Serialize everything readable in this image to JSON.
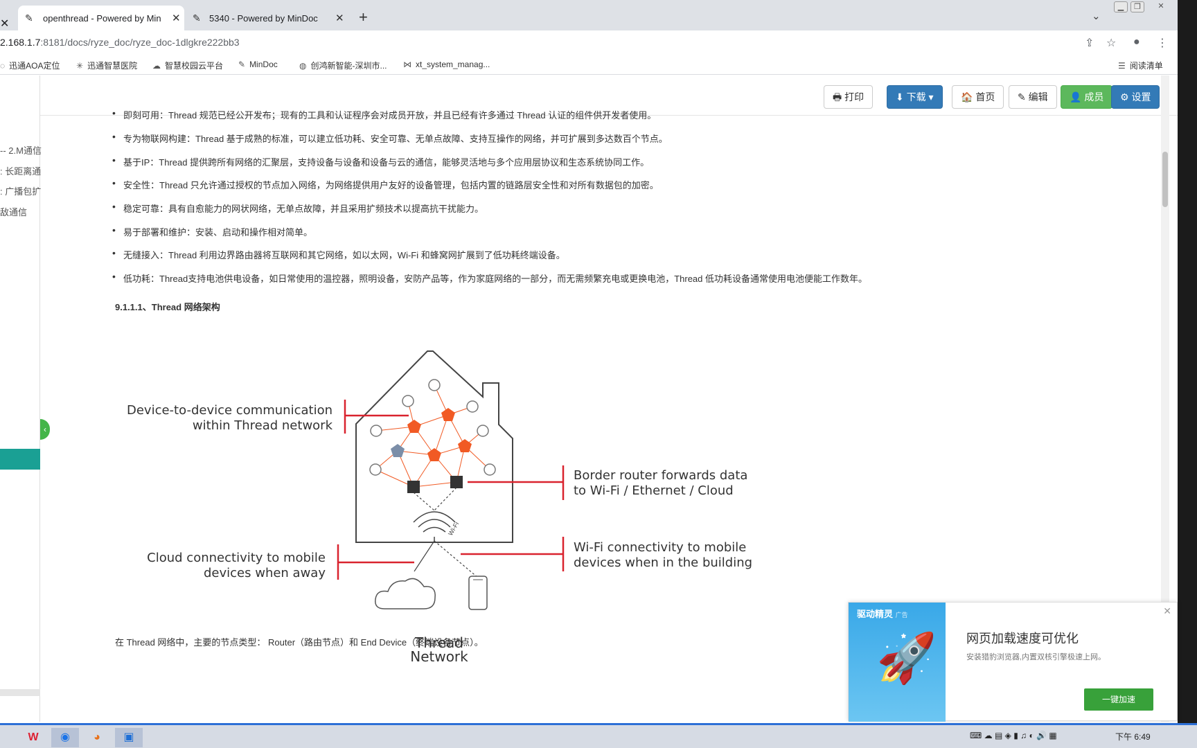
{
  "browser": {
    "tabs": [
      {
        "title": "openthread - Powered by Min",
        "active": true
      },
      {
        "title": "5340 - Powered by MinDoc",
        "active": false
      }
    ],
    "url_host": "2.168.1.7",
    "url_path": ":8181/docs/ryze_doc/ryze_doc-1dlgkre222bb3",
    "bookmarks": [
      "迅通AOA定位",
      "迅通智慧医院",
      "智慧校园云平台",
      "MinDoc",
      "创鸿新智能-深圳市...",
      "xt_system_manag..."
    ],
    "reading_list": "阅读清单"
  },
  "sidebar": {
    "items": [
      "-- 2.M通信",
      ": 长距离通",
      ": 广播包扩",
      "敌通信"
    ]
  },
  "toolbar": {
    "print": "🖶 打印",
    "download": "⬇ 下载 ▾",
    "home": "🏠 首页",
    "edit": "✎ 编辑",
    "members": "👤 成员",
    "settings": "⚙ 设置"
  },
  "doc": {
    "bullets": [
      "即刻可用：Thread 规范已经公开发布；现有的工具和认证程序会对成员开放，并且已经有许多通过 Thread 认证的组件供开发者使用。",
      "专为物联网构建：Thread 基于成熟的标准，可以建立低功耗、安全可靠、无单点故障、支持互操作的网络，并可扩展到多达数百个节点。",
      "基于IP：Thread 提供跨所有网络的汇聚层，支持设备与设备和设备与云的通信，能够灵活地与多个应用层协议和生态系统协同工作。",
      "安全性：Thread 只允许通过授权的节点加入网络，为网络提供用户友好的设备管理，包括内置的链路层安全性和对所有数据包的加密。",
      "稳定可靠：具有自愈能力的网状网络，无单点故障，并且采用扩频技术以提高抗干扰能力。",
      "易于部署和维护：安装、启动和操作相对简单。",
      "无缝接入：Thread 利用边界路由器将互联网和其它网络，如以太网，Wi-Fi 和蜂窝网扩展到了低功耗终端设备。",
      "低功耗：Thread支持电池供电设备，如日常使用的温控器，照明设备，安防产品等，作为家庭网络的一部分，而无需频繁充电或更换电池，Thread 低功耗设备通常使用电池便能工作数年。"
    ],
    "heading": "9.1.1.1、Thread 网络架构",
    "footnote": "在 Thread 网络中，主要的节点类型： Router（路由节点）和 End Device（终端设备节点）。",
    "diagram": {
      "cap1a": "Device-to-device communication",
      "cap1b": "within Thread network",
      "cap2a": "Border router forwards data",
      "cap2b": "to Wi-Fi / Ethernet / Cloud",
      "cap3a": "Cloud connectivity to mobile",
      "cap3b": "devices when away",
      "cap4a": "Wi-Fi connectivity to mobile",
      "cap4b": "devices when in the building",
      "title1": "Thread",
      "title2": "Network",
      "wifi": "Wi-Fi"
    }
  },
  "ad": {
    "brand": "驱动精灵",
    "brand_tag": "广告",
    "title": "网页加载速度可优化",
    "desc": "安装猎豹浏览器,内置双核引擎极速上网。",
    "button": "一键加速"
  },
  "taskbar": {
    "clock": "下午 6:49"
  },
  "colors": {
    "accent_orange": "#f15a24",
    "red_line": "#d9232e",
    "primary_blue": "#337ab7",
    "success_green": "#5cb85c"
  }
}
